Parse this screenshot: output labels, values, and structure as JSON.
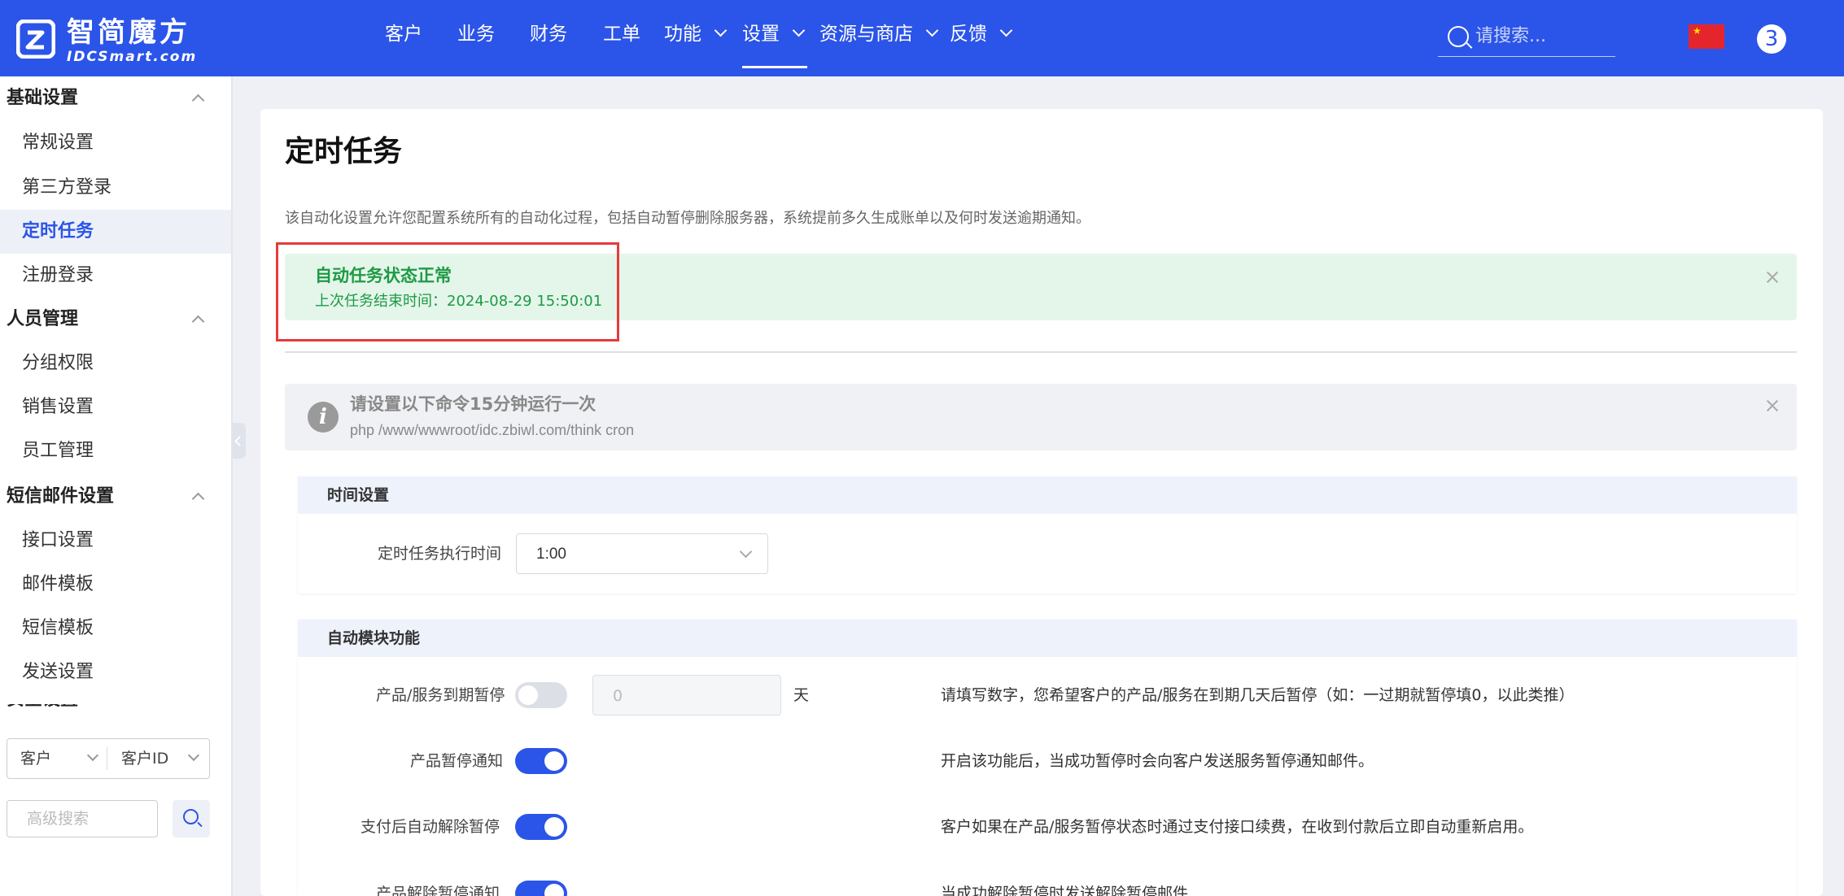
{
  "brand": {
    "name": "智简魔方",
    "sub": "IDCSmart.com"
  },
  "nav": [
    {
      "label": "客户",
      "dropdown": false
    },
    {
      "label": "业务",
      "dropdown": false
    },
    {
      "label": "财务",
      "dropdown": false
    },
    {
      "label": "工单",
      "dropdown": false
    },
    {
      "label": "功能",
      "dropdown": true
    },
    {
      "label": "设置",
      "dropdown": true,
      "active": true
    },
    {
      "label": "资源与商店",
      "dropdown": true
    },
    {
      "label": "反馈",
      "dropdown": true
    }
  ],
  "search": {
    "placeholder": "请搜索..."
  },
  "notification_count": "3",
  "sidebar": {
    "groups": [
      {
        "title": "基础设置",
        "items": [
          "常规设置",
          "第三方登录",
          "定时任务",
          "注册登录"
        ]
      },
      {
        "title": "人员管理",
        "items": [
          "分组权限",
          "销售设置",
          "员工管理"
        ]
      },
      {
        "title": "短信邮件设置",
        "items": [
          "接口设置",
          "邮件模板",
          "短信模板",
          "发送设置"
        ]
      }
    ],
    "active_item": "定时任务",
    "next_group_partial": "安全设置",
    "filter": {
      "type_value": "客户",
      "field_value": "客户ID"
    },
    "advanced_search": {
      "placeholder": "高级搜索"
    }
  },
  "main": {
    "title": "定时任务",
    "description": "该自动化设置允许您配置系统所有的自动化过程，包括自动暂停删除服务器，系统提前多久生成账单以及何时发送逾期通知。",
    "status_alert": {
      "title": "自动任务状态正常",
      "detail": "上次任务结束时间：2024-08-29 15:50:01"
    },
    "cron_alert": {
      "title": "请设置以下命令15分钟运行一次",
      "command": "php /www/wwwroot/idc.zbiwl.com/think cron"
    },
    "time_section": {
      "title": "时间设置",
      "exec_time_label": "定时任务执行时间",
      "exec_time_value": "1:00"
    },
    "auto_section": {
      "title": "自动模块功能",
      "rows": [
        {
          "label": "产品/服务到期暂停",
          "enabled": false,
          "days_value": "0",
          "unit": "天",
          "desc": "请填写数字，您希望客户的产品/服务在到期几天后暂停（如：一过期就暂停填0，以此类推）"
        },
        {
          "label": "产品暂停通知",
          "enabled": true,
          "desc": "开启该功能后，当成功暂停时会向客户发送服务暂停通知邮件。"
        },
        {
          "label": "支付后自动解除暂停",
          "enabled": true,
          "desc": "客户如果在产品/服务暂停状态时通过支付接口续费，在收到付款后立即自动重新启用。"
        },
        {
          "label": "产品解除暂停通知",
          "enabled": true,
          "desc": "当成功解除暂停时发送解除暂停邮件"
        }
      ]
    }
  },
  "colors": {
    "primary": "#2b54e8",
    "success": "#1e9a45",
    "highlight": "#e63b3b"
  }
}
